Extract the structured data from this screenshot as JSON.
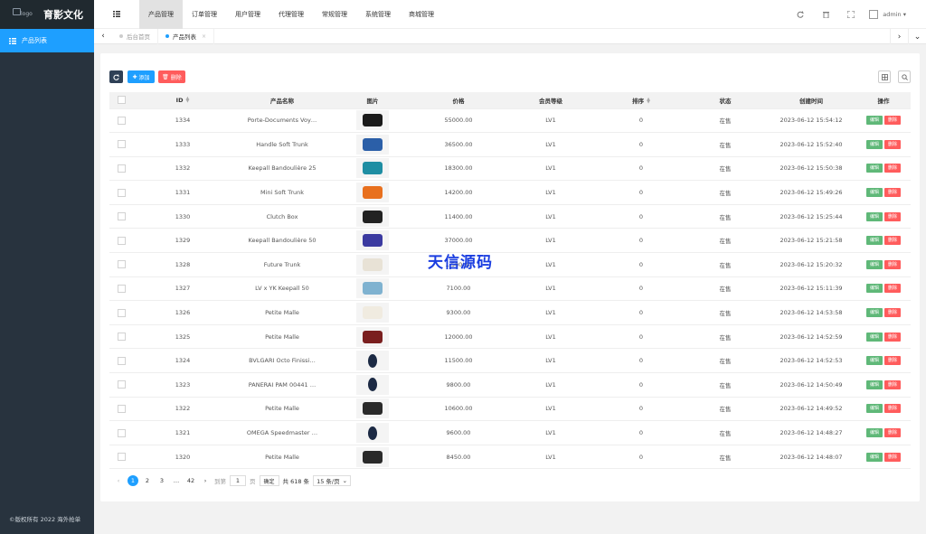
{
  "app": {
    "site_name": "育影文化",
    "logo_alt": "logo",
    "copyright": "©版权所有 2022 海外抢单"
  },
  "sidebar": {
    "items": [
      {
        "label": "产品列表",
        "icon": "list-icon",
        "active": true
      }
    ]
  },
  "header": {
    "nav": [
      {
        "label": "产品管理",
        "active": true
      },
      {
        "label": "订单管理"
      },
      {
        "label": "用户管理"
      },
      {
        "label": "代理管理"
      },
      {
        "label": "常规管理"
      },
      {
        "label": "系统管理"
      },
      {
        "label": "商城管理"
      }
    ],
    "icons": [
      "refresh-icon",
      "trash-icon",
      "fullscreen-icon"
    ],
    "user": "admin"
  },
  "tabs": [
    {
      "label": "后台首页",
      "active": false
    },
    {
      "label": "产品列表",
      "active": true,
      "close": "×"
    }
  ],
  "toolbar": {
    "add_label": "添加",
    "delete_label": "删除"
  },
  "table": {
    "columns": [
      "ID",
      "产品名称",
      "图片",
      "价格",
      "会员等级",
      "排序",
      "状态",
      "创建时间",
      "操作"
    ],
    "edit_label": "编辑",
    "delete_label": "删除",
    "rows": [
      {
        "id": "1334",
        "name": "Porte-Documents Voy…",
        "price": "55000.00",
        "level": "LV1",
        "sort": "0",
        "status": "在售",
        "created": "2023-06-12 15:54:12",
        "thumb": "black-bag"
      },
      {
        "id": "1333",
        "name": "Handle Soft Trunk",
        "price": "36500.00",
        "level": "LV1",
        "sort": "0",
        "status": "在售",
        "created": "2023-06-12 15:52:40",
        "thumb": "blue-bag"
      },
      {
        "id": "1332",
        "name": "Keepall Bandoulière 25",
        "price": "18300.00",
        "level": "LV1",
        "sort": "0",
        "status": "在售",
        "created": "2023-06-12 15:50:38",
        "thumb": "teal-bag"
      },
      {
        "id": "1331",
        "name": "Mini Soft Trunk",
        "price": "14200.00",
        "level": "LV1",
        "sort": "0",
        "status": "在售",
        "created": "2023-06-12 15:49:26",
        "thumb": "orange-bag"
      },
      {
        "id": "1330",
        "name": "Clutch Box",
        "price": "11400.00",
        "level": "LV1",
        "sort": "0",
        "status": "在售",
        "created": "2023-06-12 15:25:44",
        "thumb": "black-box"
      },
      {
        "id": "1329",
        "name": "Keepall Bandoulière 50",
        "price": "37000.00",
        "level": "LV1",
        "sort": "0",
        "status": "在售",
        "created": "2023-06-12 15:21:58",
        "thumb": "purple-bag"
      },
      {
        "id": "1328",
        "name": "Future Trunk",
        "price": "…500.00",
        "level": "LV1",
        "sort": "0",
        "status": "在售",
        "created": "2023-06-12 15:20:32",
        "thumb": "white-trunk"
      },
      {
        "id": "1327",
        "name": "LV x YK Keepall 50",
        "price": "7100.00",
        "level": "LV1",
        "sort": "0",
        "status": "在售",
        "created": "2023-06-12 15:11:39",
        "thumb": "lightblue-bag"
      },
      {
        "id": "1326",
        "name": "Petite Malle",
        "price": "9300.00",
        "level": "LV1",
        "sort": "0",
        "status": "在售",
        "created": "2023-06-12 14:53:58",
        "thumb": "white-box"
      },
      {
        "id": "1325",
        "name": "Petite Malle",
        "price": "12000.00",
        "level": "LV1",
        "sort": "0",
        "status": "在售",
        "created": "2023-06-12 14:52:59",
        "thumb": "red-trunk"
      },
      {
        "id": "1324",
        "name": "BVLGARI Octo Finissi…",
        "price": "11500.00",
        "level": "LV1",
        "sort": "0",
        "status": "在售",
        "created": "2023-06-12 14:52:53",
        "thumb": "watch"
      },
      {
        "id": "1323",
        "name": "PANERAI PAM 00441 …",
        "price": "9800.00",
        "level": "LV1",
        "sort": "0",
        "status": "在售",
        "created": "2023-06-12 14:50:49",
        "thumb": "watch"
      },
      {
        "id": "1322",
        "name": "Petite Malle",
        "price": "10600.00",
        "level": "LV1",
        "sort": "0",
        "status": "在售",
        "created": "2023-06-12 14:49:52",
        "thumb": "black-trunk"
      },
      {
        "id": "1321",
        "name": "OMEGA Speedmaster …",
        "price": "9600.00",
        "level": "LV1",
        "sort": "0",
        "status": "在售",
        "created": "2023-06-12 14:48:27",
        "thumb": "watch"
      },
      {
        "id": "1320",
        "name": "Petite Malle",
        "price": "8450.00",
        "level": "LV1",
        "sort": "0",
        "status": "在售",
        "created": "2023-06-12 14:48:07",
        "thumb": "black-trunk"
      }
    ]
  },
  "pagination": {
    "pages": [
      "1",
      "2",
      "3"
    ],
    "ellipsis": "…",
    "last": "42",
    "goto_label": "到第",
    "goto_value": "1",
    "page_unit": "页",
    "confirm": "确定",
    "total": "共 618 条",
    "per_page": "15 条/页"
  },
  "watermark": "天信源码",
  "colors": {
    "sidebar": "#28333e",
    "accent": "#1e9fff",
    "danger": "#ff5c5c",
    "success": "#5fb878"
  }
}
